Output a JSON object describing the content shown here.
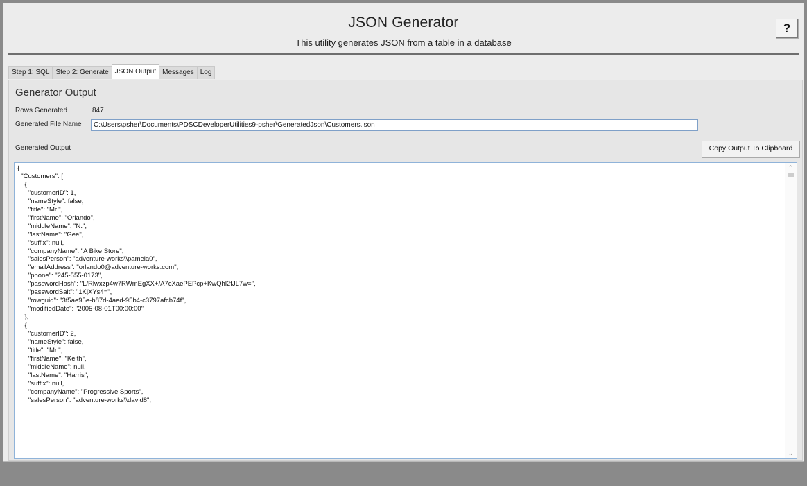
{
  "header": {
    "title": "JSON Generator",
    "subtitle": "This utility generates JSON from a table in a database",
    "help_label": "?"
  },
  "tabs": [
    {
      "label": "Step 1: SQL",
      "active": false
    },
    {
      "label": "Step 2: Generate",
      "active": false
    },
    {
      "label": "JSON Output",
      "active": true
    },
    {
      "label": "Messages",
      "active": false
    },
    {
      "label": "Log",
      "active": false
    }
  ],
  "output_panel": {
    "title": "Generator Output",
    "rows_label": "Rows Generated",
    "rows_value": "847",
    "file_label": "Generated File Name",
    "file_value": "C:\\Users\\psher\\Documents\\PDSCDeveloperUtilities9-psher\\GeneratedJson\\Customers.json",
    "output_label": "Generated Output",
    "copy_button": "Copy Output To Clipboard",
    "output_text": "{\n  \"Customers\": [\n    {\n      \"customerID\": 1,\n      \"nameStyle\": false,\n      \"title\": \"Mr.\",\n      \"firstName\": \"Orlando\",\n      \"middleName\": \"N.\",\n      \"lastName\": \"Gee\",\n      \"suffix\": null,\n      \"companyName\": \"A Bike Store\",\n      \"salesPerson\": \"adventure-works\\\\pamela0\",\n      \"emailAddress\": \"orlando0@adventure-works.com\",\n      \"phone\": \"245-555-0173\",\n      \"passwordHash\": \"L/Rlwxzp4w7RWmEgXX+/A7cXaePEPcp+KwQhl2fJL7w=\",\n      \"passwordSalt\": \"1KjXYs4=\",\n      \"rowguid\": \"3f5ae95e-b87d-4aed-95b4-c3797afcb74f\",\n      \"modifiedDate\": \"2005-08-01T00:00:00\"\n    },\n    {\n      \"customerID\": 2,\n      \"nameStyle\": false,\n      \"title\": \"Mr.\",\n      \"firstName\": \"Keith\",\n      \"middleName\": null,\n      \"lastName\": \"Harris\",\n      \"suffix\": null,\n      \"companyName\": \"Progressive Sports\",\n      \"salesPerson\": \"adventure-works\\\\david8\","
  },
  "scrollbar": {
    "up_icon": "chevron-up-icon",
    "down_icon": "chevron-down-icon"
  }
}
